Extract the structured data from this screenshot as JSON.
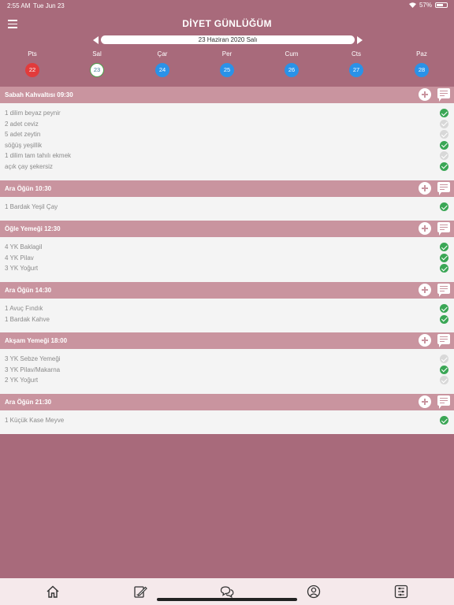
{
  "status": {
    "time": "2:55 AM",
    "date": "Tue Jun 23",
    "battery": "57%"
  },
  "title": "DİYET GÜNLÜĞÜM",
  "current_date": "23 Haziran 2020 Salı",
  "week": [
    {
      "label": "Pts",
      "num": "22",
      "state": "red"
    },
    {
      "label": "Sal",
      "num": "23",
      "state": "selected"
    },
    {
      "label": "Çar",
      "num": "24",
      "state": "blue"
    },
    {
      "label": "Per",
      "num": "25",
      "state": "blue"
    },
    {
      "label": "Cum",
      "num": "26",
      "state": "blue"
    },
    {
      "label": "Cts",
      "num": "27",
      "state": "blue"
    },
    {
      "label": "Paz",
      "num": "28",
      "state": "blue"
    }
  ],
  "meals": [
    {
      "title": "Sabah Kahvaltısı 09:30",
      "items": [
        {
          "text": "1 dilim beyaz peynir",
          "done": true
        },
        {
          "text": "2 adet ceviz",
          "done": false
        },
        {
          "text": "5 adet zeytin",
          "done": false
        },
        {
          "text": "söğüş yeşillik",
          "done": true
        },
        {
          "text": "1 dilim tam tahılı ekmek",
          "done": false
        },
        {
          "text": "açık çay şekersiz",
          "done": true
        }
      ]
    },
    {
      "title": "Ara Öğün 10:30",
      "items": [
        {
          "text": "1 Bardak Yeşil Çay",
          "done": true
        }
      ]
    },
    {
      "title": "Öğle Yemeği 12:30",
      "items": [
        {
          "text": "4 YK Baklagil",
          "done": true
        },
        {
          "text": "4 YK Pilav",
          "done": true
        },
        {
          "text": "3 YK Yoğurt",
          "done": true
        }
      ]
    },
    {
      "title": "Ara Öğün 14:30",
      "items": [
        {
          "text": "1 Avuç Fındık",
          "done": true
        },
        {
          "text": "1 Bardak Kahve",
          "done": true
        }
      ]
    },
    {
      "title": "Akşam Yemeği 18:00",
      "items": [
        {
          "text": "3 YK Sebze Yemeği",
          "done": false
        },
        {
          "text": "3 YK Pilav/Makarna",
          "done": true
        },
        {
          "text": "2 YK Yoğurt",
          "done": false
        }
      ]
    },
    {
      "title": "Ara Öğün 21:30",
      "items": [
        {
          "text": "1 Küçük Kase Meyve",
          "done": true
        }
      ]
    }
  ],
  "tabs": [
    {
      "icon": "home-icon"
    },
    {
      "icon": "edit-icon"
    },
    {
      "icon": "chat-icon"
    },
    {
      "icon": "profile-icon"
    },
    {
      "icon": "settings-sliders-icon"
    }
  ],
  "colors": {
    "background": "#a86a7b",
    "meal_header": "#c9949f",
    "checked": "#3aa655",
    "unchecked": "#d8d8d8",
    "past_day": "#e23b3b",
    "future_day": "#2a92e8"
  }
}
